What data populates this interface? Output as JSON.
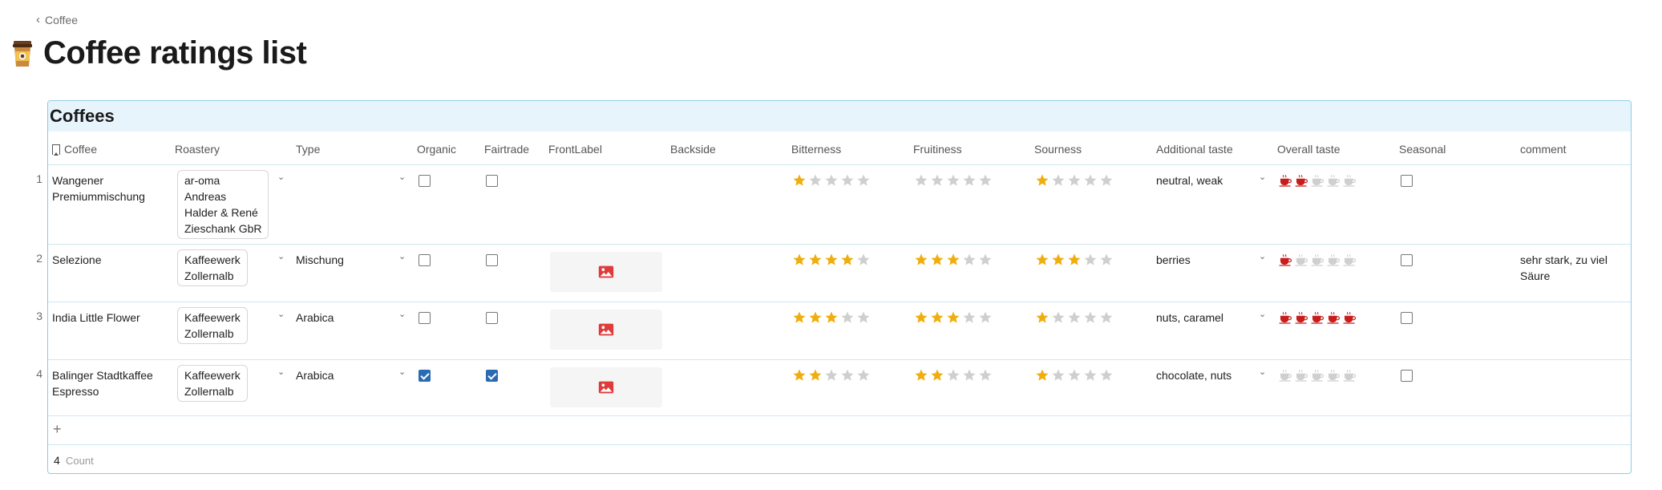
{
  "breadcrumb": {
    "label": "Coffee"
  },
  "page": {
    "title": "Coffee ratings list",
    "icon": "coffee-cup-icon"
  },
  "table": {
    "title": "Coffees",
    "columns": [
      "Coffee",
      "Roastery",
      "Type",
      "Organic",
      "Fairtrade",
      "FrontLabel",
      "Backside",
      "Bitterness",
      "Fruitiness",
      "Sourness",
      "Additional taste",
      "Overall taste",
      "Seasonal",
      "comment"
    ],
    "rows": [
      {
        "num": "1",
        "coffee_line1": "Wangener",
        "coffee_line2": "Premiummischung",
        "roastery_lines": [
          "ar-oma",
          "Andreas",
          "Halder & René",
          "Zieschank GbR"
        ],
        "type": "",
        "organic": false,
        "fairtrade": false,
        "front_label": false,
        "bitterness": 1,
        "fruitiness": 0,
        "sourness": 1,
        "additional_taste": "neutral, weak",
        "overall_taste": 2,
        "seasonal": false,
        "comment_line1": "",
        "comment_line2": ""
      },
      {
        "num": "2",
        "coffee_line1": "Selezione",
        "coffee_line2": "",
        "roastery_lines": [
          "Kaffeewerk",
          "Zollernalb"
        ],
        "type": "Mischung",
        "organic": false,
        "fairtrade": false,
        "front_label": true,
        "bitterness": 4,
        "fruitiness": 3,
        "sourness": 3,
        "additional_taste": "berries",
        "overall_taste": 1,
        "seasonal": false,
        "comment_line1": "sehr stark, zu viel",
        "comment_line2": "Säure"
      },
      {
        "num": "3",
        "coffee_line1": "India Little Flower",
        "coffee_line2": "",
        "roastery_lines": [
          "Kaffeewerk",
          "Zollernalb"
        ],
        "type": "Arabica",
        "organic": false,
        "fairtrade": false,
        "front_label": true,
        "bitterness": 3,
        "fruitiness": 3,
        "sourness": 1,
        "additional_taste": "nuts, caramel",
        "overall_taste": 5,
        "seasonal": false,
        "comment_line1": "",
        "comment_line2": ""
      },
      {
        "num": "4",
        "coffee_line1": "Balinger Stadtkaffee",
        "coffee_line2": "Espresso",
        "roastery_lines": [
          "Kaffeewerk",
          "Zollernalb"
        ],
        "type": "Arabica",
        "organic": true,
        "fairtrade": true,
        "front_label": true,
        "bitterness": 2,
        "fruitiness": 2,
        "sourness": 1,
        "additional_taste": "chocolate, nuts",
        "overall_taste": 0,
        "seasonal": false,
        "comment_line1": "",
        "comment_line2": ""
      }
    ],
    "add_row_symbol": "+",
    "count_value": "4",
    "count_label": "Count"
  },
  "colors": {
    "star_filled": "#f0ad0e",
    "star_empty": "#cfcfcf",
    "cup_filled": "#c81d1d",
    "cup_empty": "#cfcfcf",
    "accent": "#8fcbe3",
    "header_bg": "#e8f4fc",
    "checkbox_checked": "#2a6bb3",
    "image_icon": "#e03b3b"
  }
}
